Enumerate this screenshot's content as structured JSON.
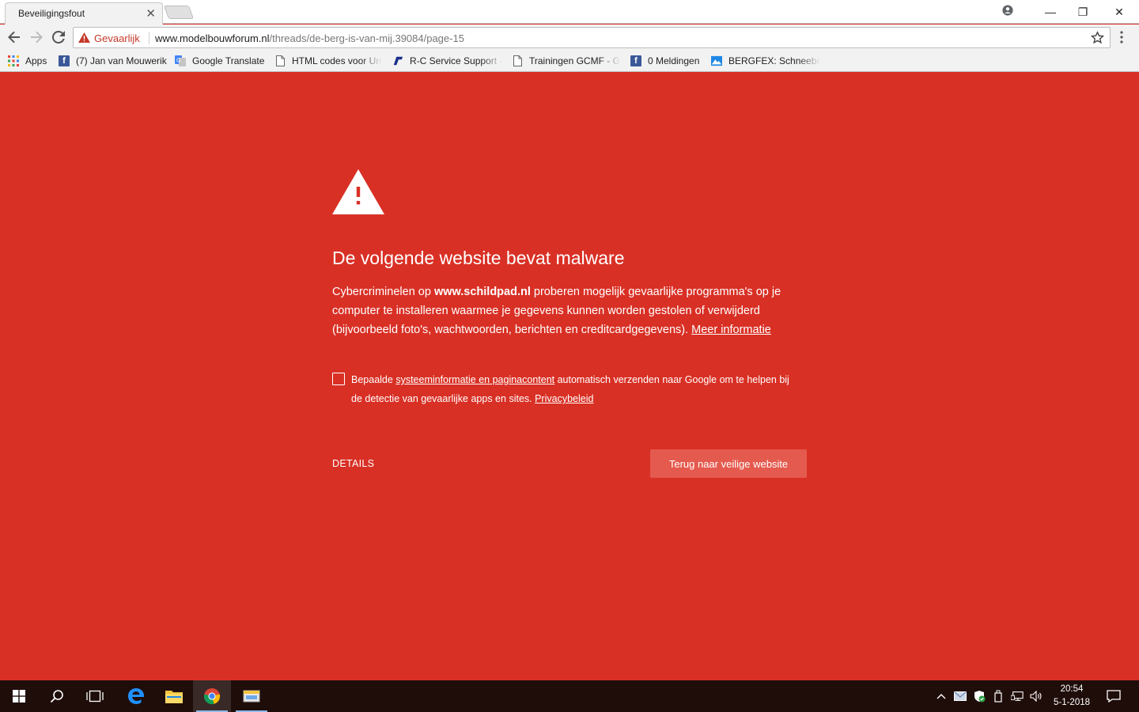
{
  "browser": {
    "tab_title": "Beveiligingsfout",
    "tab_close": "✕",
    "window_controls": {
      "minimize": "—",
      "maximize": "❐",
      "close": "✕"
    },
    "security_label": "Gevaarlijk",
    "url_host": "www.modelbouwforum.nl",
    "url_path": "/threads/de-berg-is-van-mij.39084/page-15"
  },
  "bookmarks": {
    "items": [
      {
        "label": "Apps",
        "icon": "apps-grid-icon"
      },
      {
        "label": "(7) Jan van Mouwerik",
        "icon": "facebook-icon"
      },
      {
        "label": "Google Translate",
        "icon": "google-translate-icon"
      },
      {
        "label": "HTML codes voor Uni",
        "icon": "page-icon"
      },
      {
        "label": "R-C Service Support -",
        "icon": "rc-logo-icon"
      },
      {
        "label": "Trainingen GCMF - G",
        "icon": "page-icon"
      },
      {
        "label": "0 Meldingen",
        "icon": "facebook-icon"
      },
      {
        "label": "BERGFEX: Schneeberi",
        "icon": "bergfex-icon"
      }
    ]
  },
  "interstitial": {
    "heading": "De volgende website bevat malware",
    "body_prefix": "Cybercriminelen op ",
    "body_site": "www.schildpad.nl",
    "body_suffix": " proberen mogelijk gevaarlijke programma's op je computer te installeren waarmee je gegevens kunnen worden gestolen of verwijderd (bijvoorbeeld foto's, wachtwoorden, berichten en creditcardgegevens). ",
    "learn_more": "Meer informatie",
    "optin_prefix": "Bepaalde ",
    "optin_link": "systeeminformatie en paginacontent",
    "optin_suffix": " automatisch verzenden naar Google om te helpen bij de detectie van gevaarlijke apps en sites. ",
    "privacy_link": "Privacybeleid",
    "details_label": "DETAILS",
    "back_button": "Terug naar veilige website",
    "checkbox_checked": false
  },
  "taskbar": {
    "time": "20:54",
    "date": "5-1-2018"
  },
  "colors": {
    "danger_background": "#d93025",
    "button_background": "#e55a4e",
    "taskbar": "#1f0d0a"
  }
}
